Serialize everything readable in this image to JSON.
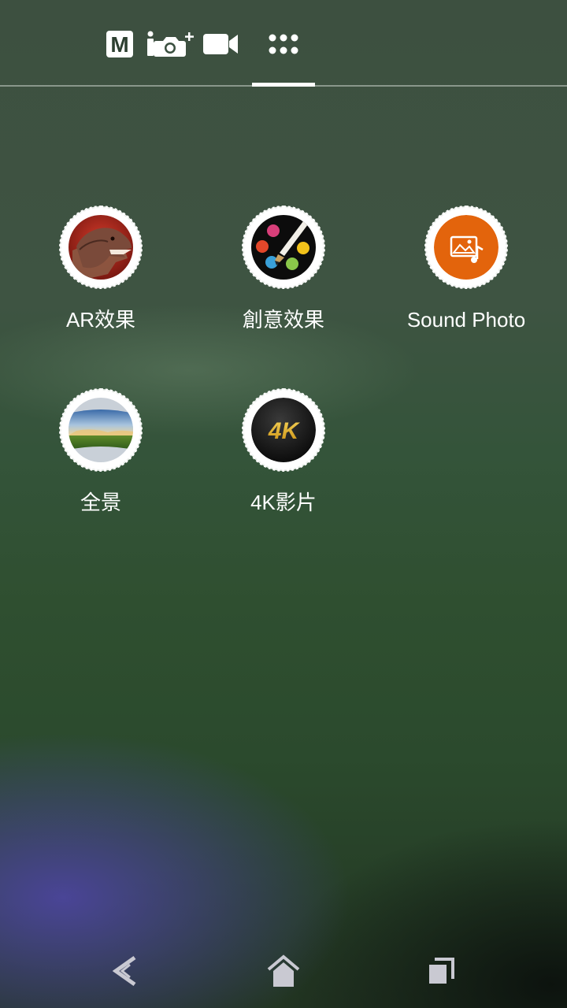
{
  "mode_bar": {
    "modes": [
      {
        "name": "manual",
        "icon": "manual-mode-icon",
        "label": "M"
      },
      {
        "name": "superior-auto",
        "icon": "camera-plus-icon"
      },
      {
        "name": "video",
        "icon": "video-camera-icon"
      },
      {
        "name": "camera-apps",
        "icon": "apps-grid-icon",
        "selected": true
      }
    ]
  },
  "apps": [
    {
      "label": "AR效果",
      "icon": "dinosaur-icon"
    },
    {
      "label": "創意效果",
      "icon": "palette-icon"
    },
    {
      "label": "Sound Photo",
      "icon": "sound-photo-icon"
    },
    {
      "label": "全景",
      "icon": "panorama-icon"
    },
    {
      "label": "4K影片",
      "icon": "4k-video-icon",
      "badge_text": "4K"
    }
  ],
  "navigation": {
    "back": "back-icon",
    "home": "home-icon",
    "recents": "recents-icon"
  },
  "colors": {
    "accent_orange": "#e3640c",
    "gold_4k": "#e8b822",
    "white": "#ffffff"
  }
}
